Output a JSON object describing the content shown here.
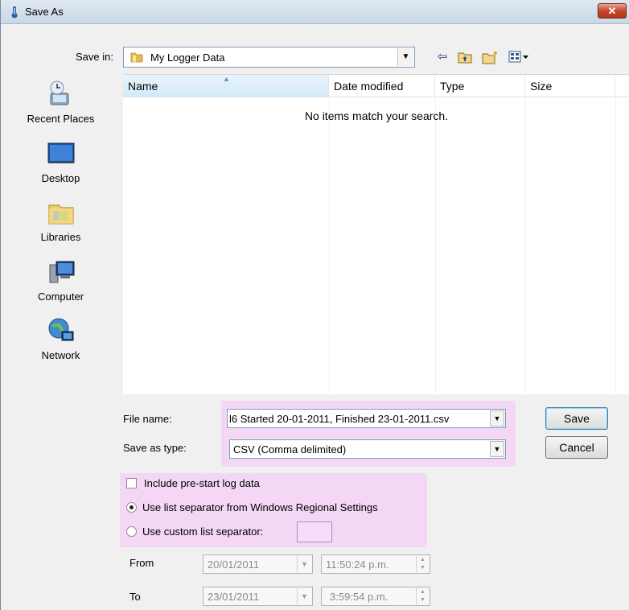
{
  "window": {
    "title": "Save As",
    "close_label": "✕"
  },
  "toolbar": {
    "save_in_label": "Save in:",
    "save_in_value": "My Logger Data",
    "icons": [
      "back-arrow-icon",
      "up-folder-icon",
      "new-folder-icon",
      "views-menu-icon"
    ]
  },
  "places": [
    {
      "label": "Recent Places",
      "icon": "recent-places-icon"
    },
    {
      "label": "Desktop",
      "icon": "desktop-icon"
    },
    {
      "label": "Libraries",
      "icon": "libraries-icon"
    },
    {
      "label": "Computer",
      "icon": "computer-icon"
    },
    {
      "label": "Network",
      "icon": "network-icon"
    }
  ],
  "file_list": {
    "columns": [
      "Name",
      "Date modified",
      "Type",
      "Size"
    ],
    "empty_message": "No items match your search."
  },
  "form": {
    "file_name_label": "File name:",
    "file_name_value": "l6 Started 20-01-2011, Finished 23-01-2011.csv",
    "save_type_label": "Save as type:",
    "save_type_value": "CSV (Comma delimited)",
    "save_button": "Save",
    "cancel_button": "Cancel"
  },
  "options": {
    "include_prestart": "Include pre-start log data",
    "use_regional": "Use list separator from Windows Regional Settings",
    "use_custom": "Use custom list separator:",
    "include_prestart_checked": false,
    "selected_separator": "regional"
  },
  "range": {
    "from_label": "From",
    "from_date": "20/01/2011",
    "from_time": "11:50:24 p.m.",
    "to_label": "To",
    "to_date": "23/01/2011",
    "to_time": "3:59:54 p.m."
  },
  "colors": {
    "highlight": "#f3d7f5",
    "title_gradient_top": "#dfe8f2",
    "close_red": "#c7472c"
  }
}
